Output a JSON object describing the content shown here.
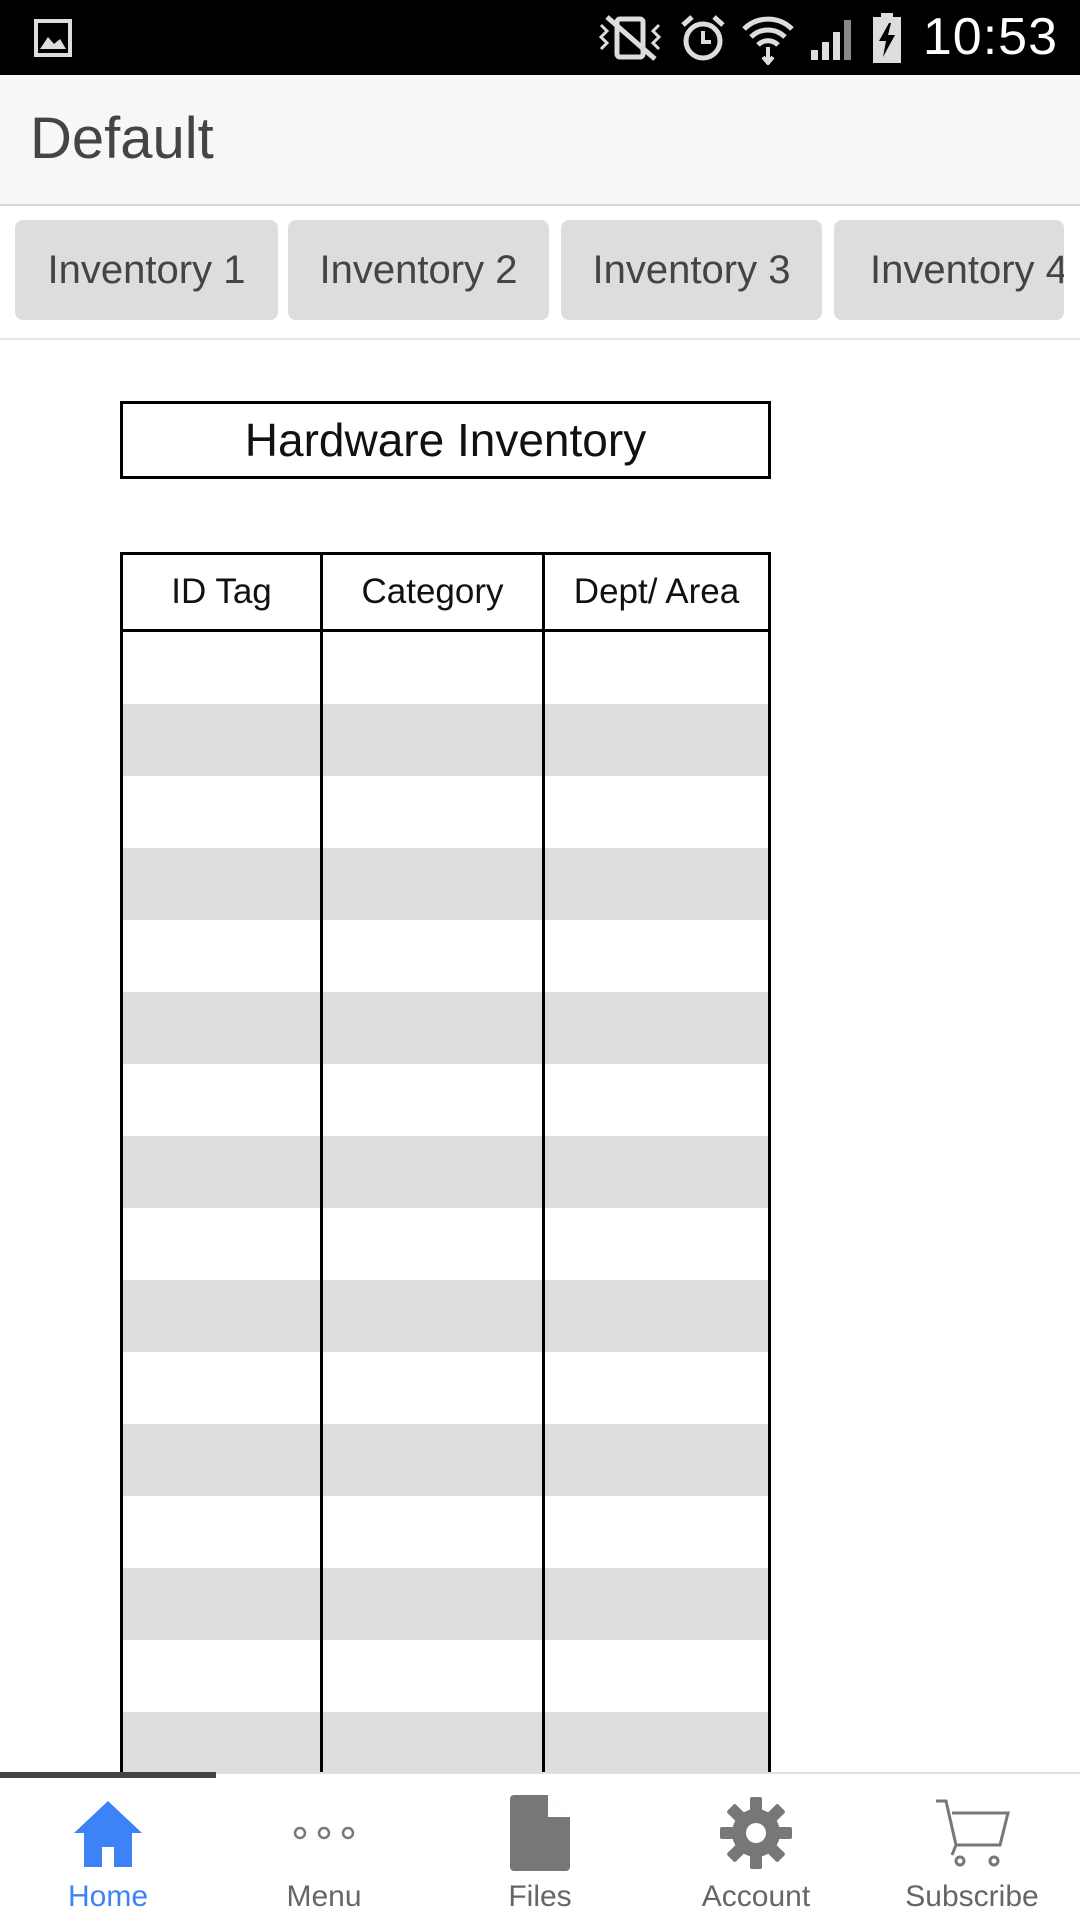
{
  "status_bar": {
    "time": "10:53",
    "icons": [
      "gallery-icon",
      "vibrate-mute-icon",
      "alarm-icon",
      "wifi-icon",
      "signal-icon",
      "battery-charging-icon"
    ]
  },
  "app_bar": {
    "title": "Default"
  },
  "tabs": [
    {
      "label": "Inventory 1"
    },
    {
      "label": "Inventory 2"
    },
    {
      "label": "Inventory 3"
    },
    {
      "label": "Inventory 4"
    }
  ],
  "sheet": {
    "title": "Hardware Inventory",
    "columns": [
      "ID Tag",
      "Category",
      "Dept/ Area"
    ],
    "rows": [
      [
        "",
        "",
        ""
      ],
      [
        "",
        "",
        ""
      ],
      [
        "",
        "",
        ""
      ],
      [
        "",
        "",
        ""
      ],
      [
        "",
        "",
        ""
      ],
      [
        "",
        "",
        ""
      ],
      [
        "",
        "",
        ""
      ],
      [
        "",
        "",
        ""
      ],
      [
        "",
        "",
        ""
      ],
      [
        "",
        "",
        ""
      ],
      [
        "",
        "",
        ""
      ],
      [
        "",
        "",
        ""
      ],
      [
        "",
        "",
        ""
      ],
      [
        "",
        "",
        ""
      ],
      [
        "",
        "",
        ""
      ],
      [
        "",
        "",
        ""
      ]
    ]
  },
  "bottom_nav": {
    "active": "Home",
    "items": [
      {
        "label": "Home",
        "icon": "home-icon"
      },
      {
        "label": "Menu",
        "icon": "more-dots-icon"
      },
      {
        "label": "Files",
        "icon": "file-icon"
      },
      {
        "label": "Account",
        "icon": "gear-icon"
      },
      {
        "label": "Subscribe",
        "icon": "cart-icon"
      }
    ]
  },
  "colors": {
    "accent": "#3e82f7",
    "tab_bg": "#dddddd",
    "row_stripe": "#dddddd",
    "status_bar": "#000000",
    "app_bar": "#f7f7f7"
  }
}
